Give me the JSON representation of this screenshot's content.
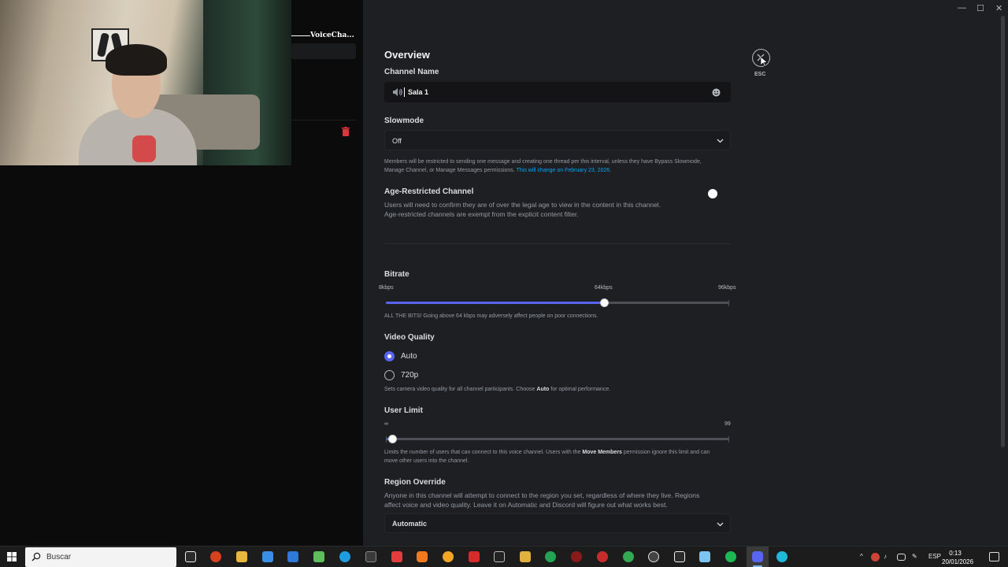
{
  "window": {
    "minimize": "—",
    "maximize": "☐",
    "close": "✕"
  },
  "sidebar": {
    "title": "VoiceCha..."
  },
  "settings": {
    "heading": "Overview",
    "channel_name": {
      "label": "Channel Name",
      "value": "Sala 1"
    },
    "slowmode": {
      "label": "Slowmode",
      "value": "Off",
      "description": "Members will be restricted to sending one message and creating one thread per this interval, unless they have Bypass Slowmode, Manage Channel, or Manage Messages permissions.",
      "link": "This will change on February 23, 2026."
    },
    "age_restricted": {
      "label": "Age-Restricted Channel",
      "description_1": "Users will need to confirm they are of over the legal age to view in the content in this channel.",
      "description_2": "Age-restricted channels are exempt from the explicit content filter.",
      "enabled": false
    },
    "bitrate": {
      "label": "Bitrate",
      "min_label": "8kbps",
      "current_label": "64kbps",
      "max_label": "96kbps",
      "min": 8,
      "max": 96,
      "value": 64,
      "description": "ALL THE BITS! Going above 64 kbps may adversely affect people on poor connections."
    },
    "video_quality": {
      "label": "Video Quality",
      "options": [
        {
          "label": "Auto",
          "selected": true
        },
        {
          "label": "720p",
          "selected": false
        }
      ],
      "description_pre": "Sets camera video quality for all channel participants. Choose",
      "description_bold": "Auto",
      "description_post": "for optimal performance."
    },
    "user_limit": {
      "label": "User Limit",
      "min_label": "∞",
      "max_label": "99",
      "value": 0,
      "description_pre": "Limits the number of users that can connect to this voice channel. Users with the",
      "description_bold": "Move Members",
      "description_post": "permission ignore this limit and can move other users into the channel."
    },
    "region_override": {
      "label": "Region Override",
      "description_1": "Anyone in this channel will attempt to connect to the region you set, regardless of where they live. Regions",
      "description_2": "affect voice and video quality. Leave it on Automatic and Discord will figure out what works best.",
      "value": "Automatic"
    },
    "close_label": "ESC"
  },
  "taskbar": {
    "search_placeholder": "Buscar",
    "language": "ESP",
    "time": "0:13",
    "date": "20/01/2026"
  },
  "colors": {
    "accent": "#5865f2",
    "link": "#00a8fc",
    "background": "#1e1f22"
  }
}
